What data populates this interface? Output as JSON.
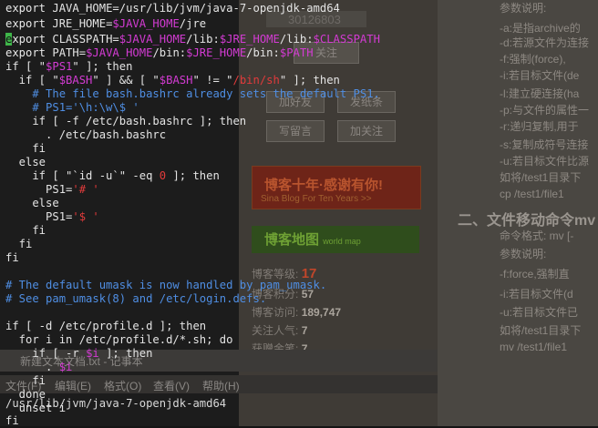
{
  "background": {
    "blog": {
      "id_number": "30126803",
      "follow_button": "关注",
      "buttons": [
        {
          "label": "加好友"
        },
        {
          "label": "发纸条"
        },
        {
          "label": "写留言"
        },
        {
          "label": "加关注"
        }
      ],
      "banner1_title": "博客十年·感谢有你!",
      "banner1_sub": "Sina Blog For Ten Years >>",
      "banner2_title": "博客地图",
      "banner2_sub": "world map",
      "stats": [
        {
          "label": "博客等级:",
          "value": "17"
        },
        {
          "label": "博客积分:",
          "value": "57"
        },
        {
          "label": "博客访问:",
          "value": "189,747"
        },
        {
          "label": "关注人气:",
          "value": "7"
        },
        {
          "label": "获赠金笔:",
          "value": "7"
        }
      ]
    },
    "article": {
      "lines": [
        "参数说明:",
        "-a:是指archive的",
        "-d:若源文件为连接",
        "-f:强制(force),",
        "-i:若目标文件(de",
        "-l:建立硬连接(ha",
        "-p:与文件的属性一",
        "-r:递归复制,用于",
        "-s:复制成符号连接",
        "-u:若目标文件比源",
        "如将/test1目录下",
        "cp /test1/file1"
      ],
      "section_heading": "二、文件移动命令mv",
      "lines2": [
        "命令格式: mv [-",
        "参数说明:",
        "-f:force,强制直",
        "-i:若目标文件(d",
        "-u:若目标文件已",
        "如将/test1目录下",
        "mv /test1/file1"
      ]
    },
    "notepad": {
      "title": "新建文本文档.txt - 记事本",
      "menu": [
        "文件(F)",
        "编辑(E)",
        "格式(O)",
        "查看(V)",
        "帮助(H)"
      ]
    }
  },
  "terminal": {
    "l1_kw": "export",
    "l1_rest": " JAVA_HOME=/usr/lib/jvm/java-7-openjdk-amd64",
    "l2_kw": "export",
    "l2_rest": " JRE_HOME=",
    "l2_var": "$JAVA_HOME",
    "l2_tail": "/jre",
    "l3_cur": "e",
    "l3_kw": "xport",
    "l3_rest": " CLASSPATH=",
    "l3_v1": "$JAVA_HOME",
    "l3_t1": "/lib:",
    "l3_v2": "$JRE_HOME",
    "l3_t2": "/lib:",
    "l3_v3": "$CLASSPATH",
    "l4_kw": "export",
    "l4_rest": " PATH=",
    "l4_v1": "$JAVA_HOME",
    "l4_t1": "/bin:",
    "l4_v2": "$JRE_HOME",
    "l4_t2": "/bin:",
    "l4_v3": "$PATH",
    "l5_a": "if [ \"",
    "l5_v": "$PS1",
    "l5_b": "\" ]; then",
    "l6_a": "  if [ \"",
    "l6_v1": "$BASH",
    "l6_b": "\" ] && [ \"",
    "l6_v2": "$BASH",
    "l6_c": "\" != \"",
    "l6_s": "/bin/sh",
    "l6_d": "\" ]; then",
    "l7_c": "    # The file bash.bashrc already sets the default PS1.",
    "l8_c": "    # PS1='\\h:\\w\\$ '",
    "l9": "    if [ -f /etc/bash.bashrc ]; then",
    "l10": "      . /etc/bash.bashrc",
    "l11": "    fi",
    "l12": "  else",
    "l13_a": "    if [ \"`id -u`\" -eq ",
    "l13_n": "0",
    "l13_b": " ]; then",
    "l14_a": "      PS1=",
    "l14_s": "'# '",
    "l15": "    else",
    "l16_a": "      PS1=",
    "l16_s": "'$ '",
    "l17": "    fi",
    "l18": "  fi",
    "l19": "fi",
    "l21_c": "# The default umask is now handled by pam_umask.",
    "l22_c": "# See pam_umask(8) and /etc/login.defs.",
    "l24": "if [ -d /etc/profile.d ]; then",
    "l25": "  for i in /etc/profile.d/*.sh; do",
    "l26_a": "    if [ -r ",
    "l26_v": "$i",
    "l26_b": " ]; then",
    "l27_a": "      . ",
    "l27_v": "$i",
    "l28": "    fi",
    "l29": "  done",
    "l30": "  unset i",
    "l31": "fi",
    "l32": "/usr/lib/jvm/java-7-openjdk-amd64"
  }
}
